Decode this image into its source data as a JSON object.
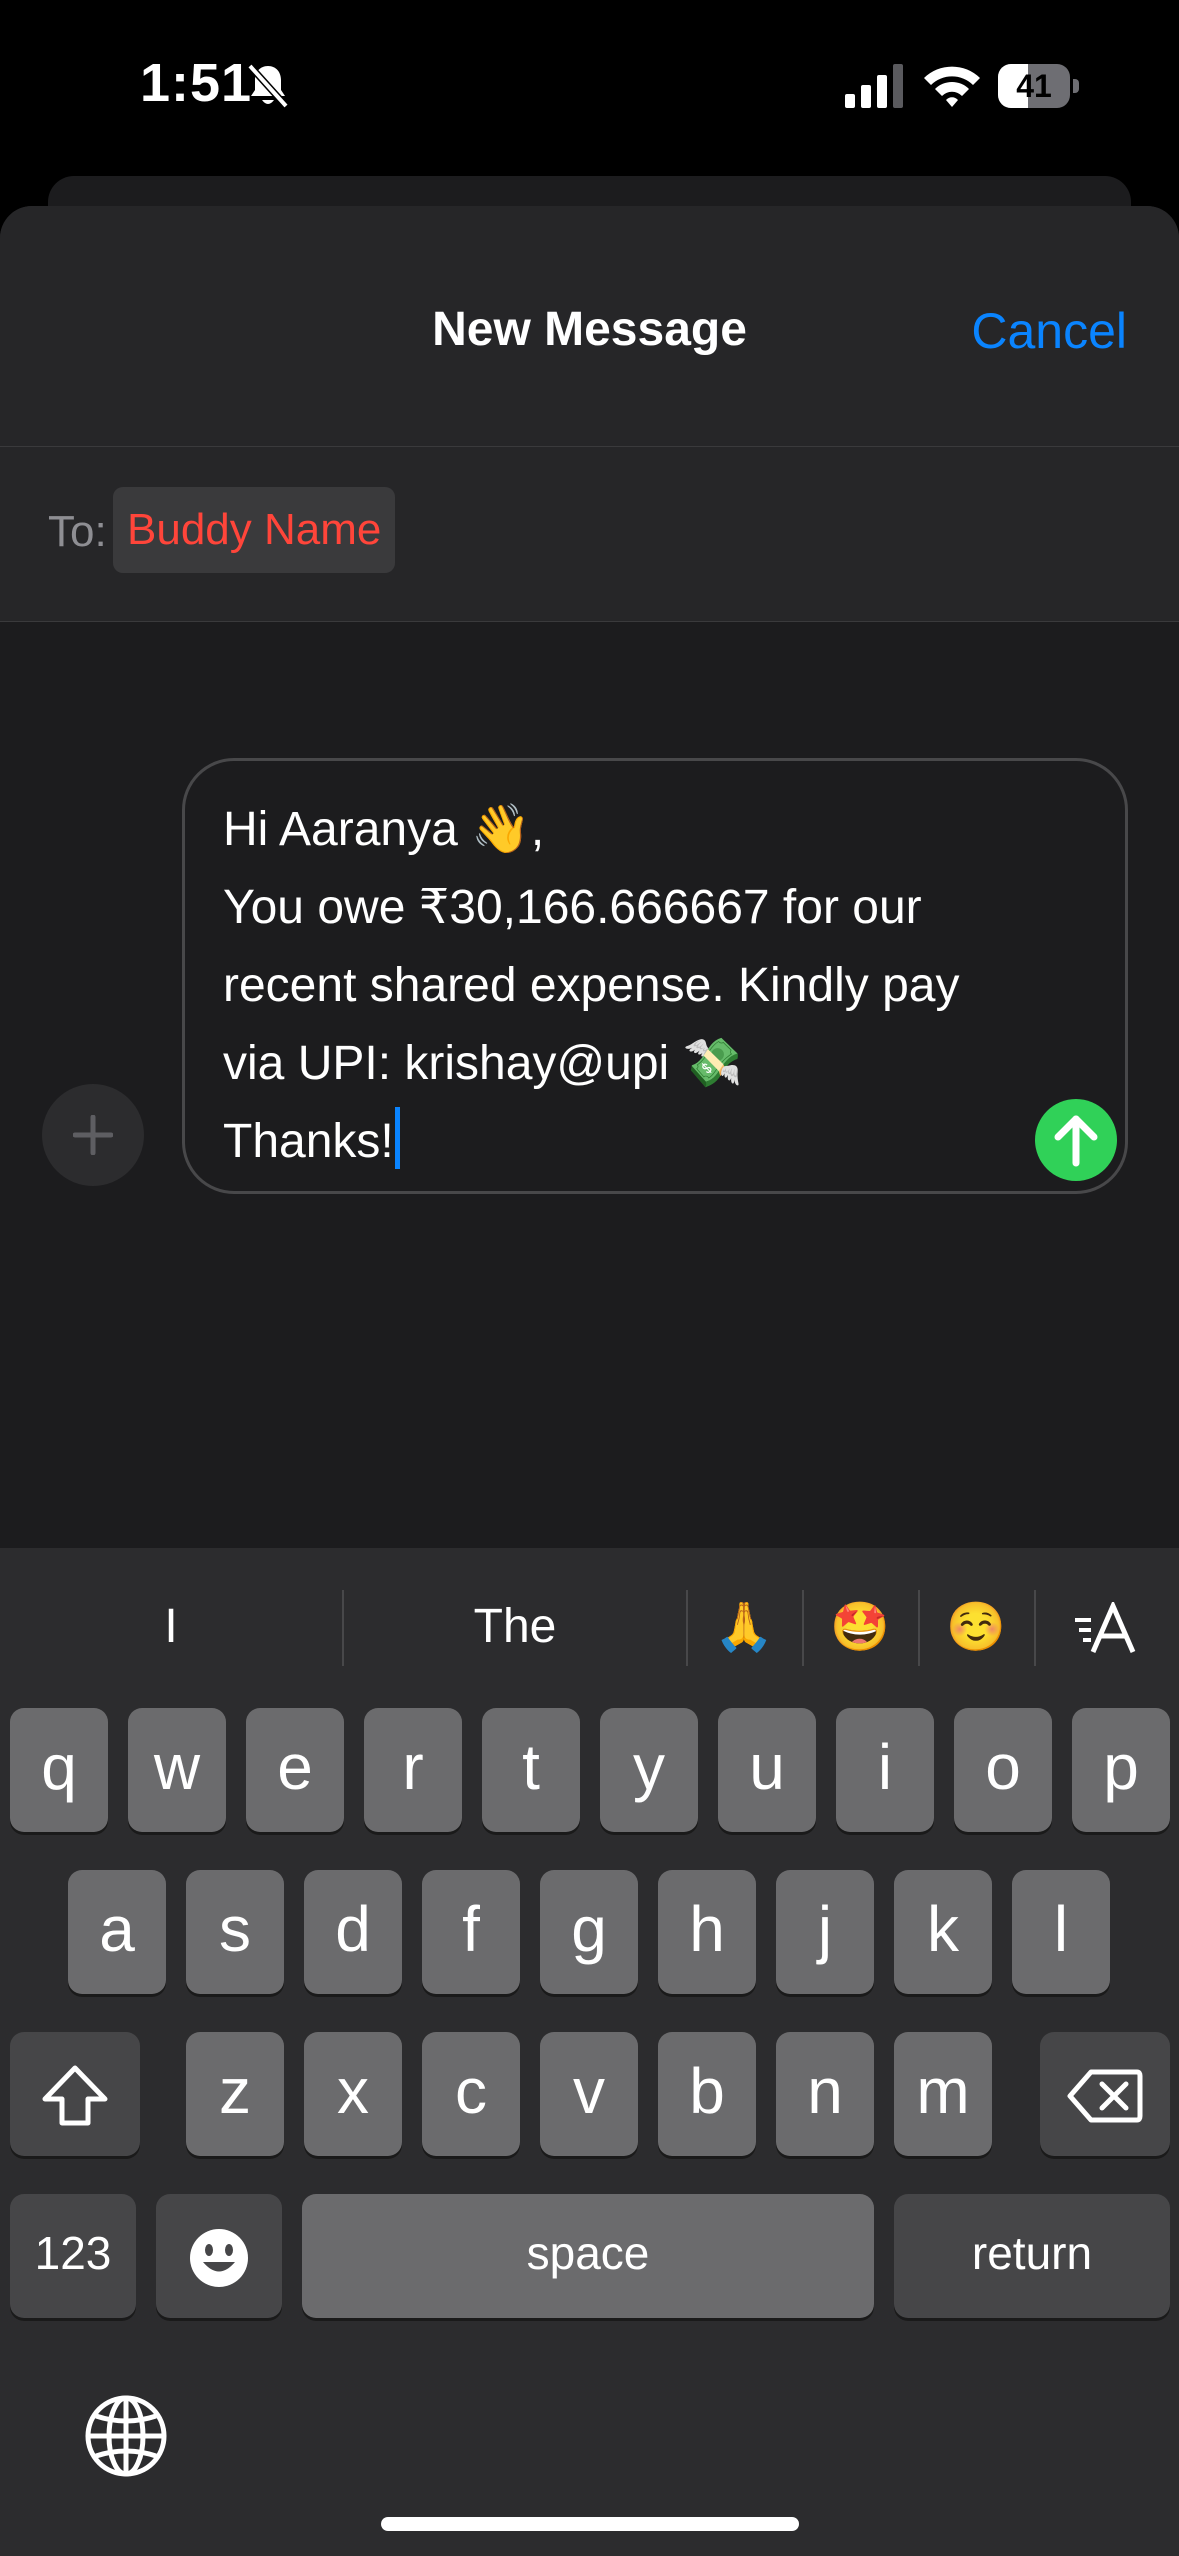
{
  "status_bar": {
    "time": "1:51",
    "battery": "41",
    "battery_level": 0.41,
    "icons": [
      "bell-slash-icon",
      "cellular-signal-icon",
      "wifi-icon",
      "battery-icon"
    ]
  },
  "header": {
    "title": "New Message",
    "cancel_label": "Cancel"
  },
  "recipient": {
    "to_label": "To:",
    "name": "Buddy Name"
  },
  "compose": {
    "message": "Hi Aaranya 👋,\nYou owe ₹30,166.666667 for our\nrecent shared expense. Kindly pay\nvia UPI: krishay@upi 💸\nThanks!",
    "add_icon": "plus-icon",
    "send_icon": "arrow-up-icon"
  },
  "predictions": [
    "I",
    "The",
    "🙏",
    "🤩",
    "☺️"
  ],
  "predictions_format_icon": "text-format-icon",
  "keyboard": {
    "row1": [
      "q",
      "w",
      "e",
      "r",
      "t",
      "y",
      "u",
      "i",
      "o",
      "p"
    ],
    "row2": [
      "a",
      "s",
      "d",
      "f",
      "g",
      "h",
      "j",
      "k",
      "l"
    ],
    "row3": [
      "z",
      "x",
      "c",
      "v",
      "b",
      "n",
      "m"
    ],
    "numbers_label": "123",
    "space_label": "space",
    "return_label": "return",
    "shift_icon": "shift-icon",
    "delete_icon": "delete-icon",
    "emoji_icon": "emoji-face-icon",
    "globe_icon": "globe-icon"
  },
  "colors": {
    "accent": "#0a84ff",
    "recipient_invalid": "#ff453a",
    "send": "#30d158"
  }
}
